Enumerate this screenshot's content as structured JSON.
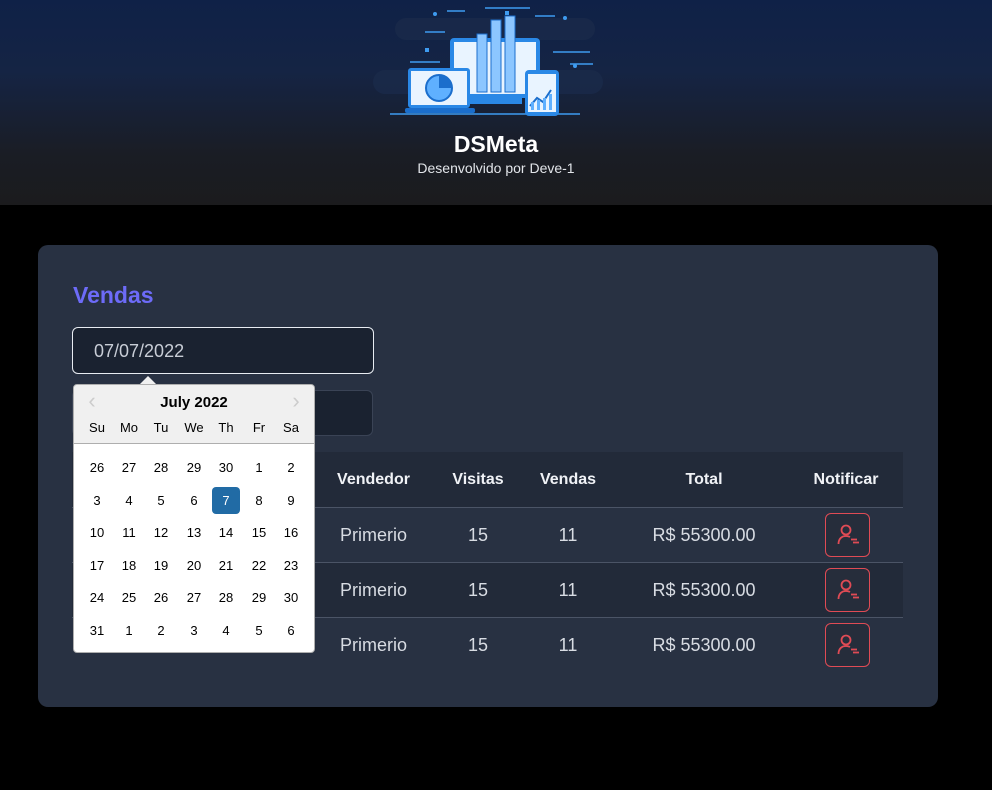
{
  "header": {
    "brand": "DSMeta",
    "subtitle": "Desenvolvido por Deve-1"
  },
  "card": {
    "title": "Vendas",
    "date_value": "07/07/2022"
  },
  "calendar": {
    "month_label": "July 2022",
    "prev_icon": "chevron-left-icon",
    "next_icon": "chevron-right-icon",
    "weekdays": [
      "Su",
      "Mo",
      "Tu",
      "We",
      "Th",
      "Fr",
      "Sa"
    ],
    "weeks": [
      [
        "26",
        "27",
        "28",
        "29",
        "30",
        "1",
        "2"
      ],
      [
        "3",
        "4",
        "5",
        "6",
        "7",
        "8",
        "9"
      ],
      [
        "10",
        "11",
        "12",
        "13",
        "14",
        "15",
        "16"
      ],
      [
        "17",
        "18",
        "19",
        "20",
        "21",
        "22",
        "23"
      ],
      [
        "24",
        "25",
        "26",
        "27",
        "28",
        "29",
        "30"
      ],
      [
        "31",
        "1",
        "2",
        "3",
        "4",
        "5",
        "6"
      ]
    ],
    "selected_day": "7",
    "selected_color": "#216ba5"
  },
  "table": {
    "headers": [
      "Vendedor",
      "Visitas",
      "Vendas",
      "Total",
      "Notificar"
    ],
    "rows": [
      {
        "vendedor": "Primerio",
        "visitas": "15",
        "vendas": "11",
        "total": "R$ 55300.00"
      },
      {
        "vendedor": "Primerio",
        "visitas": "15",
        "vendas": "11",
        "total": "R$ 55300.00"
      },
      {
        "vendedor": "Primerio",
        "visitas": "15",
        "vendas": "11",
        "total": "R$ 55300.00"
      }
    ],
    "notify_icon": "user-notify-icon",
    "notify_color": "#e04b55"
  },
  "colors": {
    "accent": "#6d6bf8",
    "card_bg": "#283142"
  }
}
